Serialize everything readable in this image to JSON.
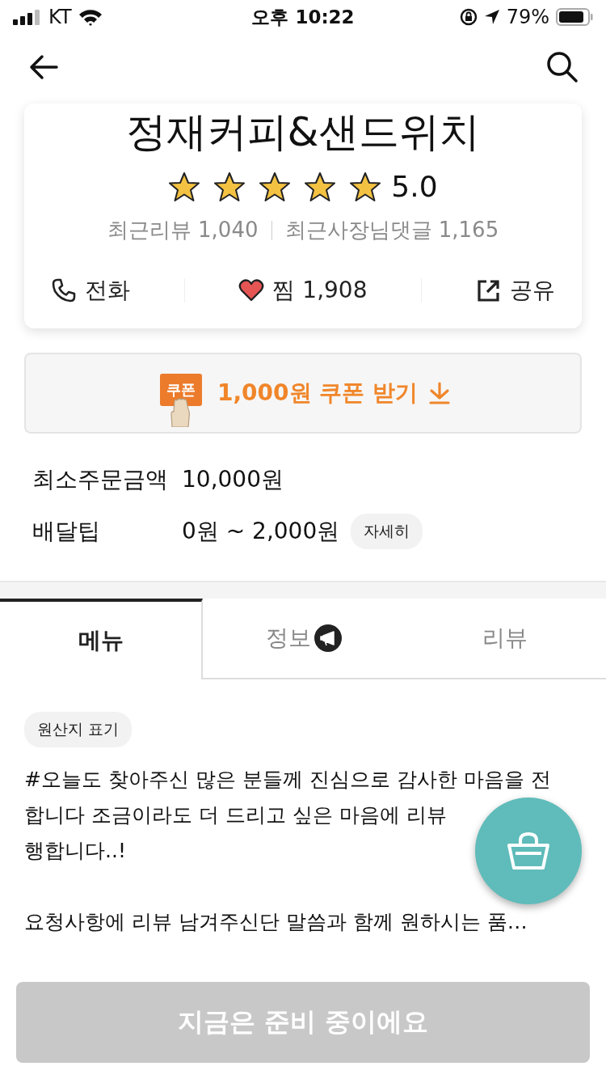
{
  "status_bar": {
    "carrier": "KT",
    "time": "오후 10:22",
    "battery": "79%"
  },
  "store": {
    "name": "정재커피&샌드위치",
    "stars": 5,
    "rating": "5.0",
    "review_count": "최근리뷰 1,040",
    "reply_count": "최근사장님댓글 1,165",
    "actions": [
      {
        "kind": "phone",
        "label": "전화"
      },
      {
        "kind": "heart",
        "label": "찜 1,908"
      },
      {
        "kind": "share",
        "label": "공유"
      }
    ]
  },
  "coupon": {
    "badge": "쿠폰",
    "label": "1,000원 쿠폰 받기"
  },
  "info": [
    {
      "label": "최소주문금액",
      "value": "10,000원"
    },
    {
      "label": "배달팁",
      "value": "0원 ~ 2,000원",
      "detail": "자세히"
    }
  ],
  "tabs": [
    {
      "label": "메뉴",
      "selected": true,
      "badge": false
    },
    {
      "label": "정보",
      "selected": false,
      "badge": true
    },
    {
      "label": "리뷰",
      "selected": false,
      "badge": false
    }
  ],
  "origin_chip": "원산지 표기",
  "notice_paragraphs": [
    [
      "#오늘도 찾아주신 많은 분들께 진심으로 감사한 마음을 전",
      "합니다 조금이라도 더 드리고 싶은 마음에 리뷰",
      "행합니다..!"
    ],
    [
      "요청사항에 리뷰 남겨주신단 말씀과 함께 원하시는 품…"
    ]
  ],
  "order_button": {
    "label": "지금은 준비 중이에요",
    "disabled": true
  }
}
